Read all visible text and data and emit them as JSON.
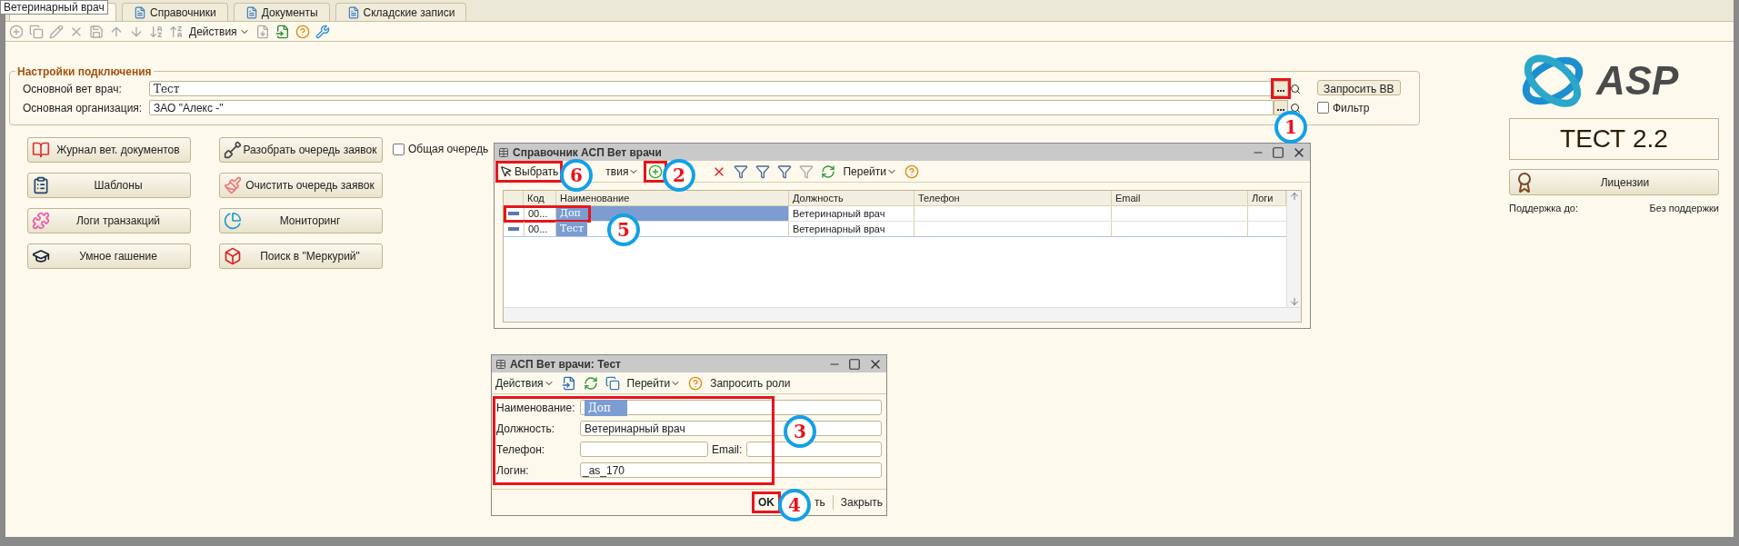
{
  "tooltip": "Ветеринарный врач",
  "tabs": [
    {
      "selected": true
    },
    {
      "label": "Справочники",
      "selected": false
    },
    {
      "label": "Документы",
      "selected": false
    },
    {
      "label": "Складские записи",
      "selected": false
    }
  ],
  "toolbar": {
    "actions": "Действия"
  },
  "settings": {
    "title": "Настройки подключения",
    "fields": [
      {
        "label": "Основной вет врач:",
        "value": "Тест",
        "pick_framed": true
      },
      {
        "label": "Основная организация:",
        "value": "ЗАО \"Алекс  -\"",
        "pick_framed": false
      }
    ],
    "request_button": "Запросить ВВ",
    "filter": {
      "label": "Фильтр",
      "checked": false
    }
  },
  "buttons_left": [
    "Журнал вет. документов",
    "Шаблоны",
    "Логи транзакций",
    "Умное гашение"
  ],
  "buttons_right": [
    "Разобрать очередь заявок",
    "Очистить очередь заявок",
    "Мониторинг",
    "Поиск в \"Меркурий\""
  ],
  "common_queue": {
    "label": "Общая очередь",
    "checked": false
  },
  "brand": {
    "logo_text": "ASP",
    "version": "ТЕСТ 2.2",
    "license_button": "Лицензии",
    "support_label": "Поддержка до:",
    "support_value": "Без поддержки"
  },
  "catalog_window": {
    "title": "Справочник АСП Вет врачи",
    "select_button": {
      "label": "Выбрать",
      "framed": true
    },
    "actions": "твия",
    "add_framed": true,
    "goto": "Перейти",
    "columns": [
      "Код",
      "Наименование",
      "Должность",
      "Телефон",
      "Email",
      "Логи"
    ],
    "rows": [
      {
        "code": "00...",
        "name": "Доп",
        "position": "Ветеринарный врач",
        "selected": true,
        "framed": true
      },
      {
        "code": "00...",
        "name": "Тест",
        "position": "Ветеринарный врач",
        "selected": false,
        "framed": false
      }
    ]
  },
  "item_window": {
    "title": "АСП Вет врачи: Тест",
    "actions": "Действия",
    "goto": "Перейти",
    "request_roles": "Запросить роли",
    "fields": [
      {
        "label": "Наименование:",
        "value": "Доп",
        "highlighted": true
      },
      {
        "label": "Должность:",
        "value": "Ветеринарный врач",
        "highlighted": false
      }
    ],
    "phone_label": "Телефон:",
    "email_label": "Email:",
    "login": {
      "label": "Логин:",
      "value": "_as_170"
    },
    "fields_framed": true,
    "ok_button": {
      "label": "OK",
      "framed": true
    },
    "save_button": "ть",
    "close_button": "Закрыть"
  },
  "callouts": [
    "1",
    "2",
    "3",
    "4",
    "5",
    "6"
  ]
}
